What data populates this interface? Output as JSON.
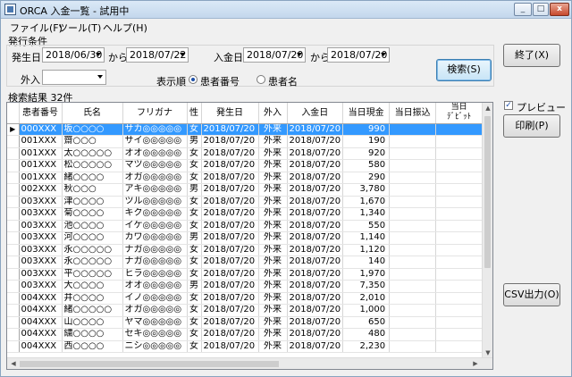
{
  "window": {
    "title": "ORCA 入金一覧 - 試用中",
    "min": "_",
    "max": "□",
    "close": "x"
  },
  "menu": [
    "ファイル(F)",
    "ツール(T)",
    "ヘルプ(H)"
  ],
  "criteria": {
    "group_label": "発行条件",
    "issue_date_label": "発生日",
    "issue_from": "2018/06/30",
    "kara1": "から",
    "issue_to": "2018/07/22",
    "pay_date_label": "入金日",
    "pay_from": "2018/07/20",
    "kara2": "から",
    "pay_to": "2018/07/20",
    "inout_label": "外入",
    "inout_value": "",
    "order_label": "表示順",
    "order_opt1": "患者番号",
    "order_opt2": "患者名"
  },
  "buttons": {
    "search": "検索(S)",
    "exit": "終了(X)",
    "print": "印刷(P)",
    "csv": "CSV出力(O)"
  },
  "preview_label": "プレビュー",
  "results": {
    "label": "検索結果",
    "count": "32件",
    "columns": [
      "患者番号",
      "氏名",
      "フリガナ",
      "性",
      "発生日",
      "外入",
      "入金日",
      "当日現金",
      "当日振込",
      "当日\nﾃﾞﾋﾞｯﾄ"
    ],
    "rows": [
      [
        "000XXX",
        "坂○○○○",
        "サカ◎◎◎◎◎",
        "女",
        "2018/07/20",
        "外来",
        "2018/07/20",
        "990",
        ""
      ],
      [
        "001XXX",
        "齋○○○",
        "サイ◎◎◎◎◎",
        "男",
        "2018/07/20",
        "外来",
        "2018/07/20",
        "190",
        ""
      ],
      [
        "001XXX",
        "太○○○○○",
        "オオ◎◎◎◎◎",
        "女",
        "2018/07/20",
        "外来",
        "2018/07/20",
        "920",
        ""
      ],
      [
        "001XXX",
        "松○○○○○",
        "マツ◎◎◎◎◎",
        "女",
        "2018/07/20",
        "外来",
        "2018/07/20",
        "580",
        ""
      ],
      [
        "001XXX",
        "緒○○○○",
        "オガ◎◎◎◎◎",
        "女",
        "2018/07/20",
        "外来",
        "2018/07/20",
        "290",
        ""
      ],
      [
        "002XXX",
        "秋○○○",
        "アキ◎◎◎◎◎",
        "男",
        "2018/07/20",
        "外来",
        "2018/07/20",
        "3,780",
        ""
      ],
      [
        "003XXX",
        "津○○○○",
        "ツル◎◎◎◎◎",
        "女",
        "2018/07/20",
        "外来",
        "2018/07/20",
        "1,670",
        ""
      ],
      [
        "003XXX",
        "菊○○○○",
        "キク◎◎◎◎◎",
        "女",
        "2018/07/20",
        "外来",
        "2018/07/20",
        "1,340",
        ""
      ],
      [
        "003XXX",
        "池○○○○",
        "イケ◎◎◎◎◎",
        "女",
        "2018/07/20",
        "外来",
        "2018/07/20",
        "550",
        ""
      ],
      [
        "003XXX",
        "河○○○○",
        "カワ◎◎◎◎◎",
        "男",
        "2018/07/20",
        "外来",
        "2018/07/20",
        "1,140",
        ""
      ],
      [
        "003XXX",
        "永○○○○○",
        "ナガ◎◎◎◎◎",
        "女",
        "2018/07/20",
        "外来",
        "2018/07/20",
        "1,120",
        ""
      ],
      [
        "003XXX",
        "永○○○○○",
        "ナガ◎◎◎◎◎",
        "女",
        "2018/07/20",
        "外来",
        "2018/07/20",
        "140",
        ""
      ],
      [
        "003XXX",
        "平○○○○○",
        "ヒラ◎◎◎◎◎",
        "女",
        "2018/07/20",
        "外来",
        "2018/07/20",
        "1,970",
        ""
      ],
      [
        "003XXX",
        "大○○○○",
        "オオ◎◎◎◎◎",
        "男",
        "2018/07/20",
        "外来",
        "2018/07/20",
        "7,350",
        ""
      ],
      [
        "004XXX",
        "井○○○○",
        "イノ◎◎◎◎◎",
        "女",
        "2018/07/20",
        "外来",
        "2018/07/20",
        "2,010",
        ""
      ],
      [
        "004XXX",
        "緒○○○○○",
        "オガ◎◎◎◎◎",
        "女",
        "2018/07/20",
        "外来",
        "2018/07/20",
        "1,000",
        ""
      ],
      [
        "004XXX",
        "山○○○○",
        "ヤマ◎◎◎◎◎",
        "女",
        "2018/07/20",
        "外来",
        "2018/07/20",
        "650",
        ""
      ],
      [
        "004XXX",
        "繍○○○○",
        "セキ◎◎◎◎◎",
        "女",
        "2018/07/20",
        "外来",
        "2018/07/20",
        "480",
        ""
      ],
      [
        "004XXX",
        "西○○○○",
        "ニシ◎◎◎◎◎",
        "女",
        "2018/07/20",
        "外来",
        "2018/07/20",
        "2,230",
        ""
      ]
    ],
    "selected_row": 0
  },
  "colors": {
    "selection": "#3399ff",
    "title_bar": "#c3d7ec"
  },
  "icons": {
    "row_pointer": "triangle-right-icon",
    "scroll_up": "up-arrow-icon",
    "scroll_down": "down-arrow-icon"
  }
}
